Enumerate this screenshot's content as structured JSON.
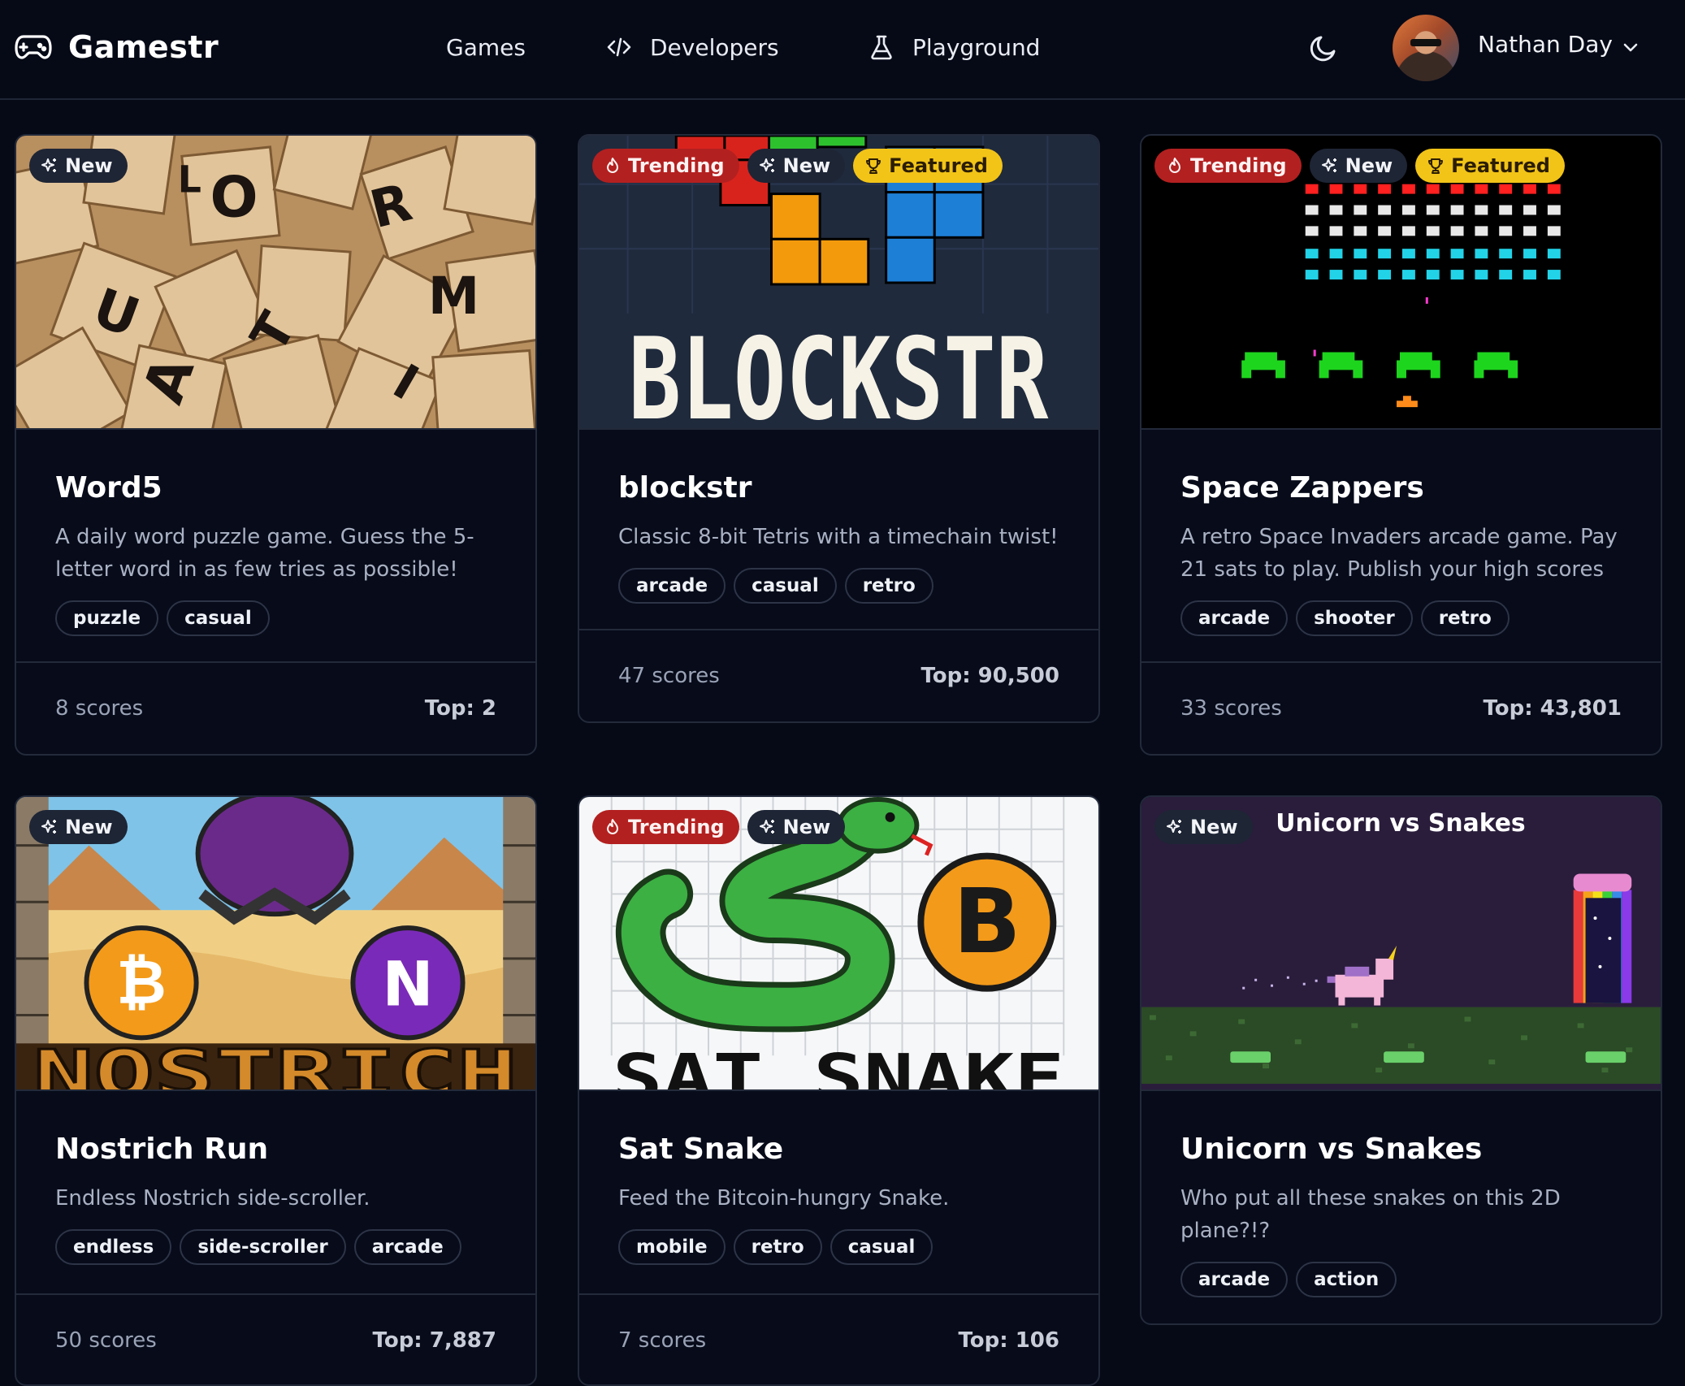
{
  "header": {
    "brand": "Gamestr",
    "nav": [
      {
        "label": "Games"
      },
      {
        "label": "Developers"
      },
      {
        "label": "Playground"
      }
    ],
    "user": {
      "name": "Nathan Day"
    }
  },
  "badge_labels": {
    "new": "New",
    "trending": "Trending",
    "featured": "Featured"
  },
  "cards": [
    {
      "title": "Word5",
      "description": "A daily word puzzle game. Guess the 5-letter word in as few tries as possible!",
      "tags": [
        "puzzle",
        "casual"
      ],
      "scores": "8 scores",
      "top": "Top: 2"
    },
    {
      "title": "blockstr",
      "description": "Classic 8-bit Tetris with a timechain twist!",
      "tags": [
        "arcade",
        "casual",
        "retro"
      ],
      "scores": "47 scores",
      "top": "Top: 90,500",
      "art_text": "BLOCKSTR"
    },
    {
      "title": "Space Zappers",
      "description": "A retro Space Invaders arcade game. Pay 21 sats to play. Publish your high scores to t…",
      "tags": [
        "arcade",
        "shooter",
        "retro"
      ],
      "scores": "33 scores",
      "top": "Top: 43,801"
    },
    {
      "title": "Nostrich Run",
      "description": "Endless Nostrich side-scroller.",
      "tags": [
        "endless",
        "side-scroller",
        "arcade"
      ],
      "scores": "50 scores",
      "top": "Top: 7,887",
      "art_text": "NOSTRICH"
    },
    {
      "title": "Sat Snake",
      "description": "Feed the Bitcoin-hungry Snake.",
      "tags": [
        "mobile",
        "retro",
        "casual"
      ],
      "scores": "7 scores",
      "top": "Top: 106",
      "art_text": "SAT SNAKE"
    },
    {
      "title": "Unicorn vs Snakes",
      "description": "Who put all these snakes on this 2D plane?!?",
      "tags": [
        "arcade",
        "action"
      ],
      "art_text": "Unicorn vs Snakes"
    }
  ],
  "colors": {
    "background": "#060a17",
    "trending": "#b32020",
    "featured": "#f2c418",
    "new": "#1e2535"
  }
}
